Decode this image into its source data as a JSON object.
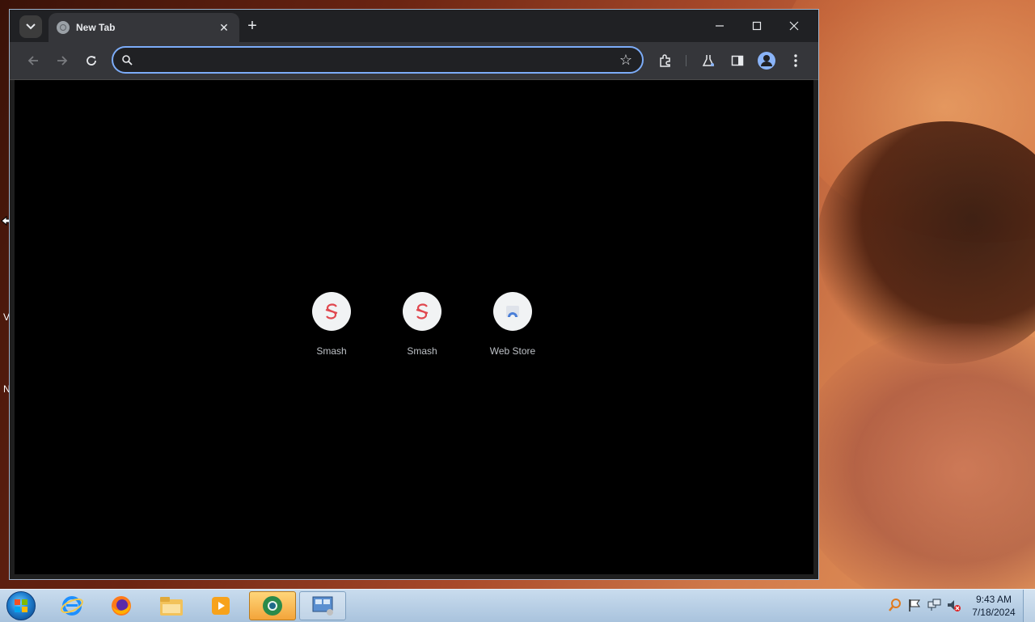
{
  "desktop": {
    "edge_glyphs": [
      "V",
      "N"
    ]
  },
  "browser": {
    "tab": {
      "title": "New Tab"
    },
    "omnibox": {
      "value": "",
      "placeholder": ""
    },
    "shortcuts": [
      {
        "label": "Smash",
        "icon": "smash-icon"
      },
      {
        "label": "Smash",
        "icon": "smash-icon"
      },
      {
        "label": "Web Store",
        "icon": "web-store-icon"
      }
    ]
  },
  "taskbar": {
    "apps": [
      "internet-explorer-icon",
      "firefox-icon",
      "windows-explorer-icon",
      "media-player-icon",
      "chrome-icon",
      "control-panel-icon"
    ],
    "clock": {
      "time": "9:43 AM",
      "date": "7/18/2024"
    }
  },
  "colors": {
    "accent": "#7cacf8",
    "window_bg": "#35363a",
    "page_bg": "#000000"
  }
}
